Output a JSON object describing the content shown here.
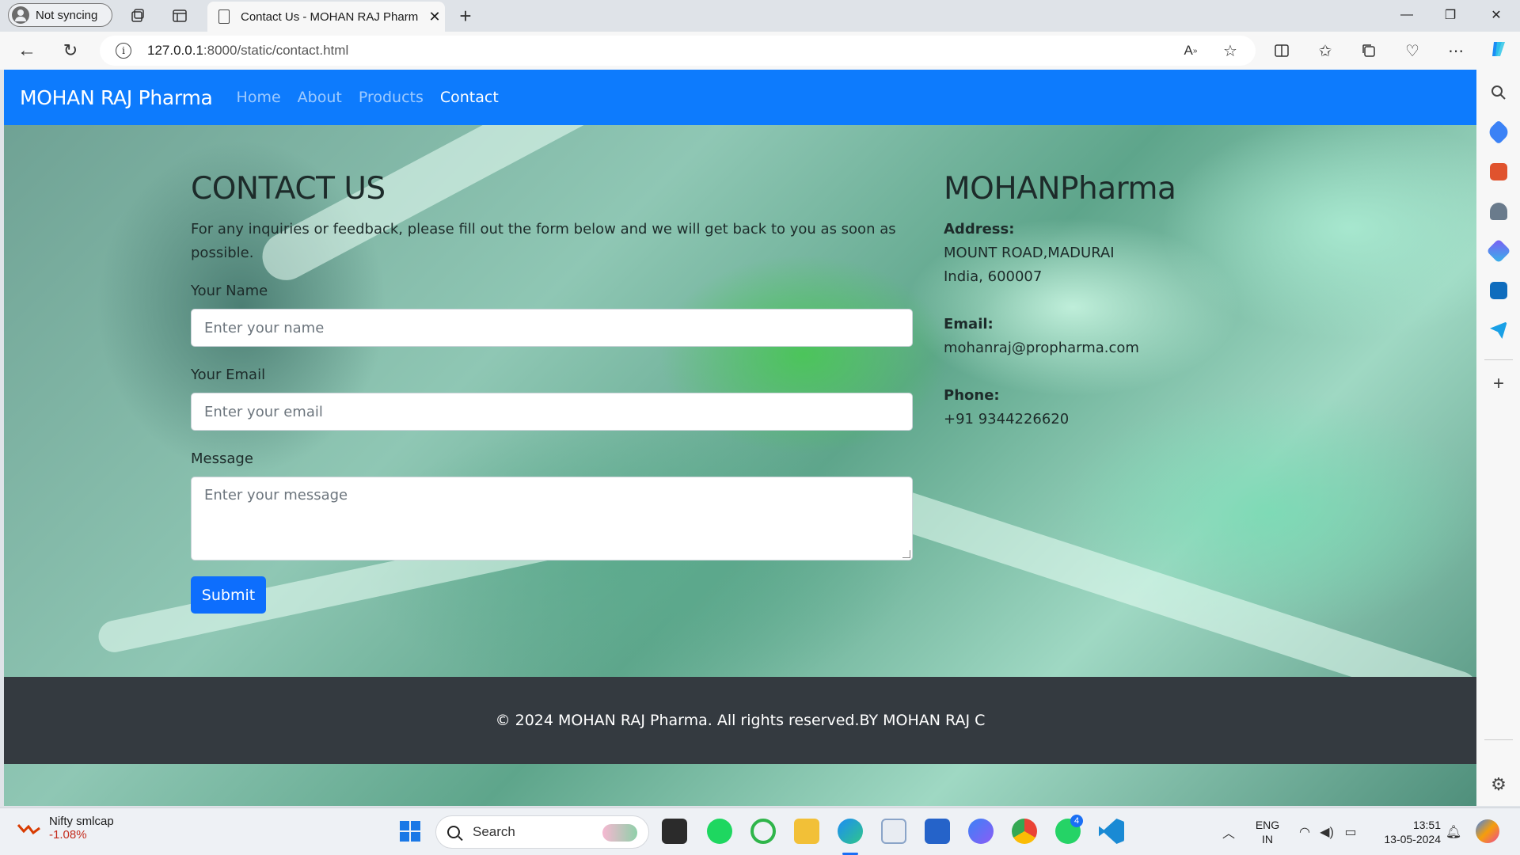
{
  "browser": {
    "profile_label": "Not syncing",
    "tab_title": "Contact Us - MOHAN RAJ Pharm",
    "url_host": "127.0.0.1",
    "url_path": ":8000/static/contact.html"
  },
  "site": {
    "brand": "MOHAN RAJ Pharma",
    "nav": [
      {
        "label": "Home"
      },
      {
        "label": "About"
      },
      {
        "label": "Products"
      },
      {
        "label": "Contact"
      }
    ],
    "contact": {
      "heading": "CONTACT US",
      "intro": "For any inquiries or feedback, please fill out the form below and we will get back to you as soon as possible.",
      "name_label": "Your Name",
      "name_placeholder": "Enter your name",
      "email_label": "Your Email",
      "email_placeholder": "Enter your email",
      "message_label": "Message",
      "message_placeholder": "Enter your message",
      "submit_label": "Submit"
    },
    "info": {
      "company": "MOHANPharma",
      "address_label": "Address:",
      "address_line1": "MOUNT ROAD,MADURAI",
      "address_line2": "India, 600007",
      "email_label": "Email:",
      "email": "mohanraj@propharma.com",
      "phone_label": "Phone:",
      "phone": "+91 9344226620"
    },
    "footer_text": "© 2024 MOHAN RAJ Pharma. All rights reserved.BY MOHAN RAJ C"
  },
  "taskbar": {
    "ticker_name": "Nifty smlcap",
    "ticker_change": "-1.08%",
    "search_label": "Search",
    "lang_line1": "ENG",
    "lang_line2": "IN",
    "time": "13:51",
    "date": "13-05-2024",
    "whatsapp_badge": "4"
  },
  "colors": {
    "navbar": "#0d7bfd",
    "button": "#0d6efd",
    "footer": "#343a40"
  }
}
